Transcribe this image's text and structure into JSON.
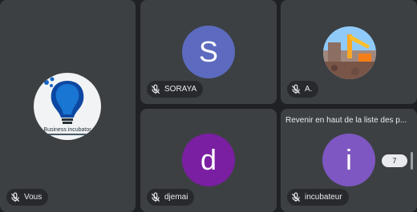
{
  "participants": {
    "you": {
      "name": "Vous",
      "logo_text": "Business incubator"
    },
    "soraya": {
      "name": "SORAYA",
      "initial": "S",
      "color": "#5c6bc0"
    },
    "a": {
      "name": "A."
    },
    "djemai": {
      "name": "djemai",
      "initial": "d",
      "color": "#7b1fa2"
    },
    "incubateur": {
      "name": "incubateur",
      "initial": "i",
      "color": "#7e57c2"
    }
  },
  "banner": {
    "text": "Revenir en haut de la liste des p..."
  },
  "more_count": "7",
  "icons": {
    "mic": "mic-off-icon"
  }
}
